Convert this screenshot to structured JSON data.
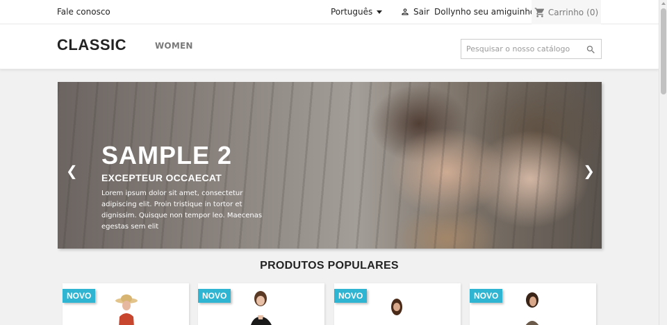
{
  "topnav": {
    "contact_label": "Fale conosco",
    "language_label": "Português",
    "signout_label": "Sair",
    "account_name": "Dollynho seu amiguinho",
    "cart_label": "Carrinho",
    "cart_count": "(0)"
  },
  "header": {
    "logo_text": "CLASSIC",
    "menu": [
      {
        "label": "WOMEN"
      }
    ],
    "search_placeholder": "Pesquisar o nosso catálogo"
  },
  "carousel": {
    "title": "SAMPLE 2",
    "subtitle": "EXCEPTEUR OCCAECAT",
    "description": "Lorem ipsum dolor sit amet, consectetur adipiscing elit. Proin tristique in tortor et dignissim. Quisque non tempor leo. Maecenas egestas sem elit",
    "prev_icon": "chevron-left-icon",
    "next_icon": "chevron-right-icon"
  },
  "products_section": {
    "title": "PRODUTOS POPULARES",
    "items": [
      {
        "badge": "NOVO"
      },
      {
        "badge": "NOVO"
      },
      {
        "badge": "NOVO"
      },
      {
        "badge": "NOVO"
      }
    ]
  },
  "colors": {
    "accent": "#2fb5d2",
    "text": "#232323",
    "muted": "#7a7a7a",
    "background": "#f1f1f1"
  }
}
